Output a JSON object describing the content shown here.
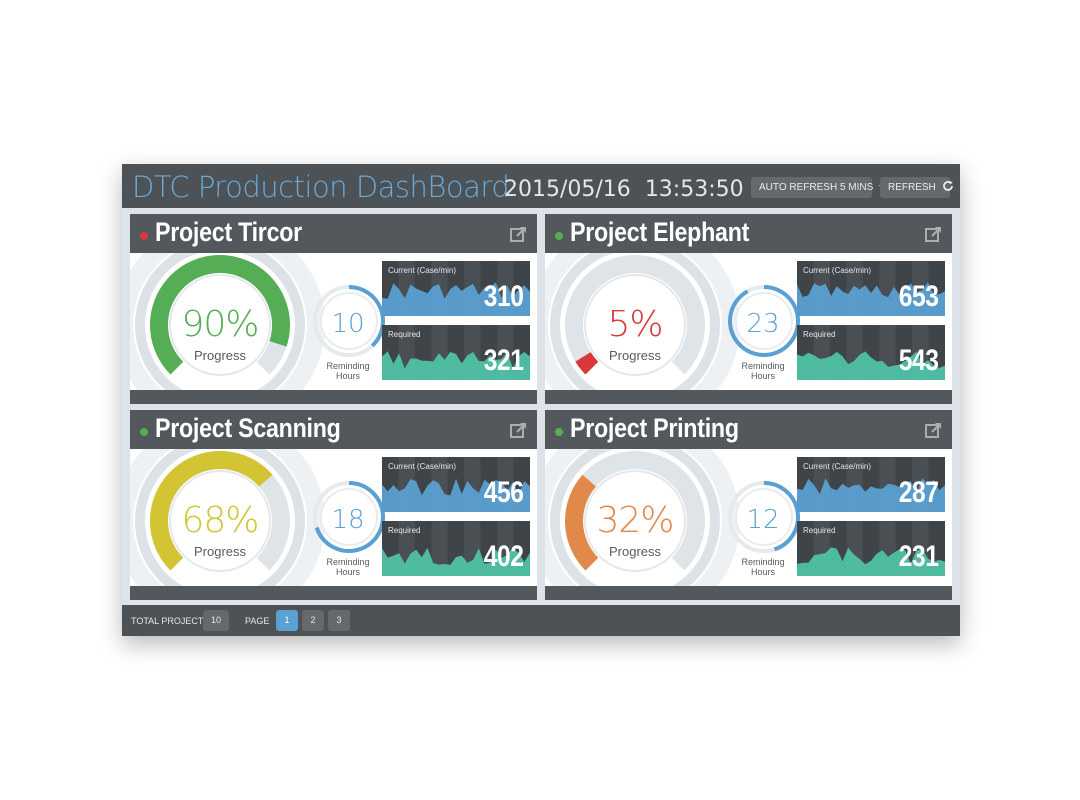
{
  "header": {
    "title": "DTC Production DashBoard",
    "date": "2015/05/16",
    "time": "13:53:50",
    "auto_refresh_label": "AUTO REFRESH 5 MINS",
    "refresh_label": "REFRESH"
  },
  "labels": {
    "progress": "Progress",
    "reminding": "Reminding",
    "hours": "Hours",
    "current": "Current (Case/min)",
    "required": "Required"
  },
  "projects": [
    {
      "name": "Project Tircor",
      "status_color": "#d9383a",
      "progress": "90%",
      "progress_value": 0.9,
      "progress_color": "#55ad55",
      "text_color": "#55ad55",
      "hours": "10",
      "hours_fraction": 0.38,
      "current": "310",
      "required": "321"
    },
    {
      "name": "Project Elephant",
      "status_color": "#55ad55",
      "progress": "5%",
      "progress_value": 0.05,
      "progress_color": "#d9383a",
      "text_color": "#d9383a",
      "hours": "23",
      "hours_fraction": 0.92,
      "current": "653",
      "required": "543"
    },
    {
      "name": "Project Scanning",
      "status_color": "#55ad55",
      "progress": "68%",
      "progress_value": 0.68,
      "progress_color": "#d2c433",
      "text_color": "#d2c433",
      "hours": "18",
      "hours_fraction": 0.7,
      "current": "456",
      "required": "402"
    },
    {
      "name": "Project Printing",
      "status_color": "#55ad55",
      "progress": "32%",
      "progress_value": 0.32,
      "progress_color": "#e0894a",
      "text_color": "#e0894a",
      "hours": "12",
      "hours_fraction": 0.45,
      "current": "287",
      "required": "231"
    }
  ],
  "footer": {
    "total_label": "TOTAL PROJECT",
    "total_value": "10",
    "page_label": "PAGE",
    "pages": [
      "1",
      "2",
      "3"
    ],
    "active_page": "1"
  },
  "colors": {
    "accent": "#5aa0d2",
    "current_fill": "#5aa0d2",
    "required_fill": "#4fc2a6"
  }
}
